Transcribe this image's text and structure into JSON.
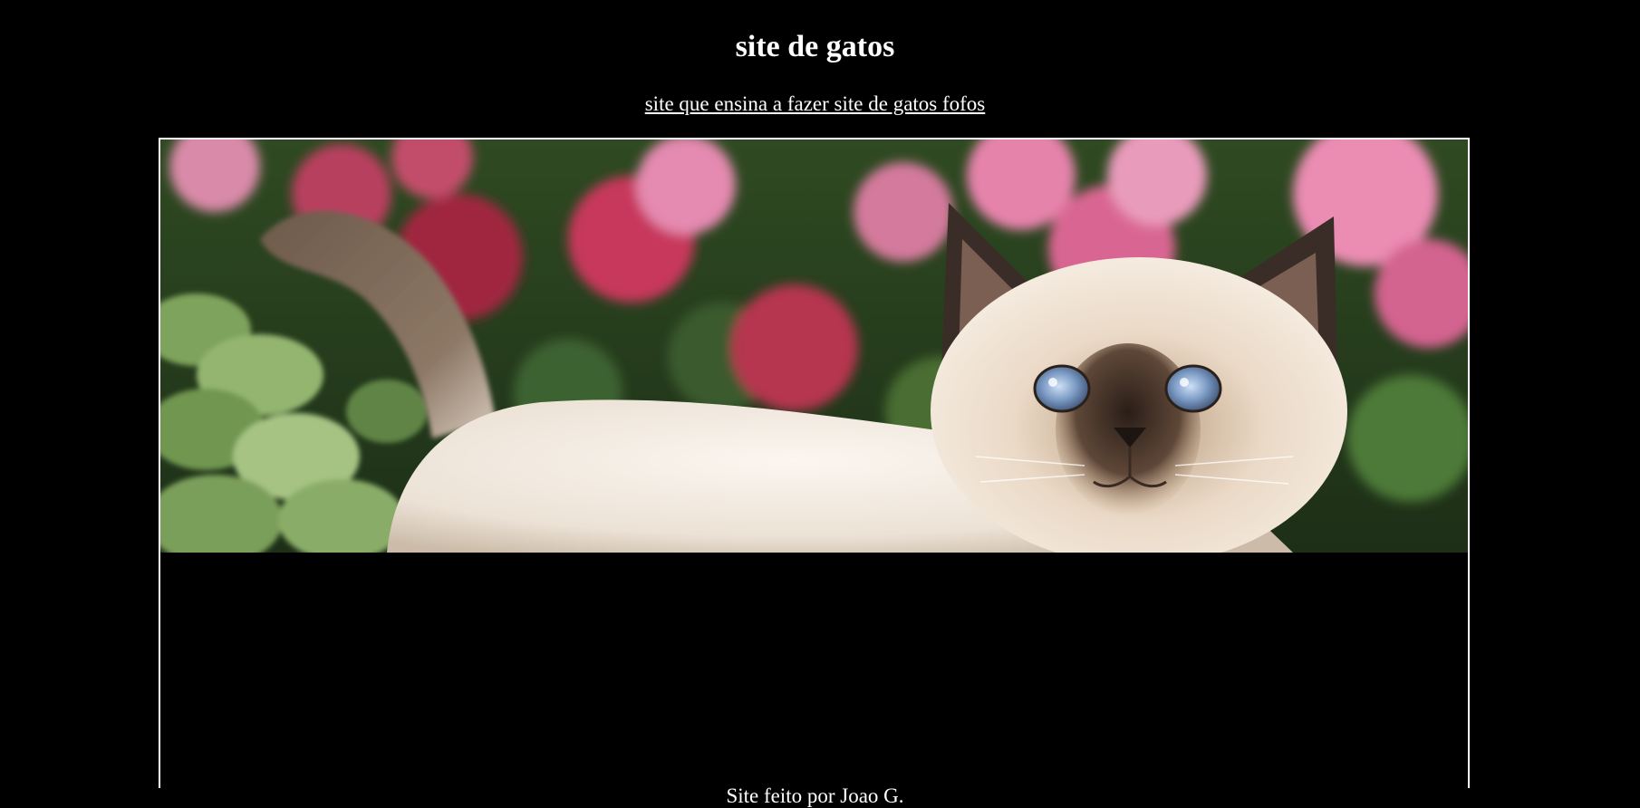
{
  "header": {
    "title": "site de gatos",
    "tagline_link": "site que ensina a fazer site de gatos fofos"
  },
  "banner": {
    "image_subject": "kitten-with-flowers",
    "colors": {
      "background": "#000000",
      "text": "#ffffff",
      "border": "#ffffff"
    }
  },
  "footer": {
    "credit": "Site feito por Joao G."
  }
}
